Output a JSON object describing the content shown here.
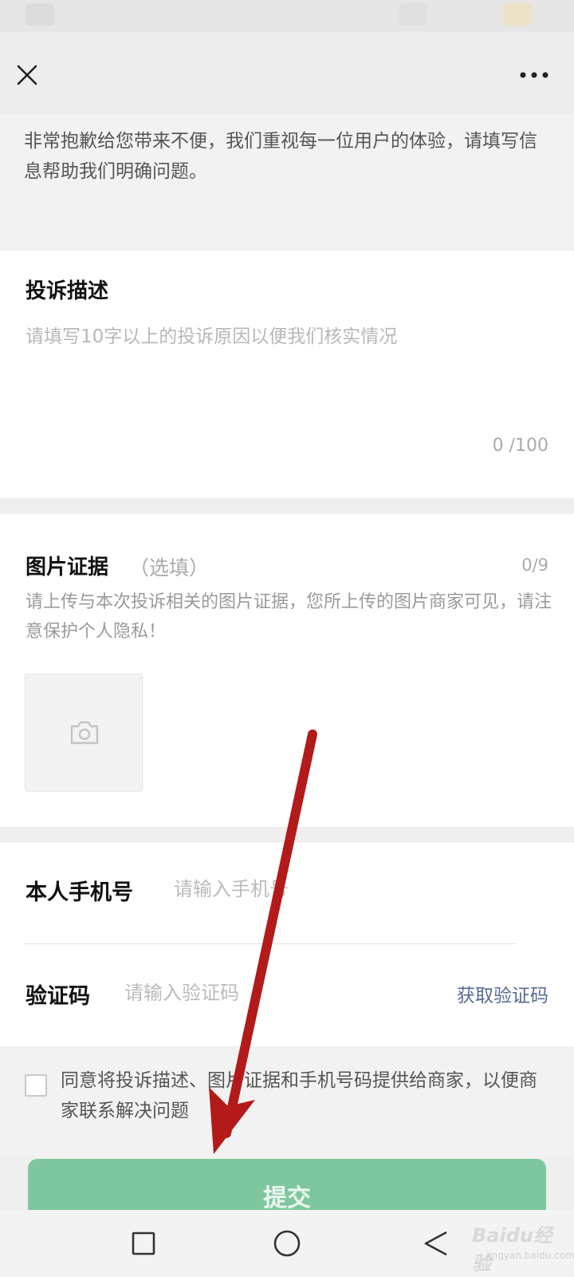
{
  "header": {
    "close_icon": "close-icon",
    "more_icon": "more-horizontal-icon"
  },
  "intro": {
    "text": "非常抱歉给您带来不便，我们重视每一位用户的体验，请填写信息帮助我们明确问题。"
  },
  "description": {
    "title": "投诉描述",
    "placeholder": "请填写10字以上的投诉原因以便我们核实情况",
    "value": "",
    "counter": "0 /100"
  },
  "photos": {
    "title": "图片证据",
    "optional": "（选填）",
    "counter": "0/9",
    "hint": "请上传与本次投诉相关的图片证据，您所上传的图片商家可见，请注意保护个人隐私！",
    "upload_icon": "camera-icon"
  },
  "phone": {
    "label": "本人手机号",
    "placeholder": "请输入手机号",
    "value": ""
  },
  "code": {
    "label": "验证码",
    "placeholder": "请输入验证码",
    "value": "",
    "get_code_label": "获取验证码"
  },
  "agreement": {
    "checked": false,
    "text": "同意将投诉描述、图片证据和手机号码提供给商家，以便商家联系解决问题"
  },
  "submit": {
    "label": "提交"
  },
  "navbar": {
    "recents_icon": "square-icon",
    "home_icon": "circle-icon",
    "back_icon": "triangle-back-icon"
  },
  "watermark": {
    "main": "Baidu经验",
    "sub": "jingyan.baidu.com"
  },
  "colors": {
    "submit_bg": "#7ec79e",
    "link": "#576b95",
    "annotation_arrow": "#b31a1a"
  }
}
